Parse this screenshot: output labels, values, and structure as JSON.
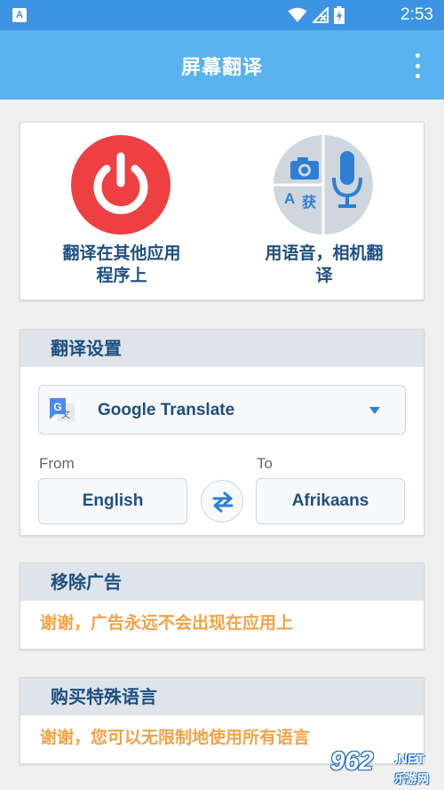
{
  "status_bar": {
    "notification_letter": "A",
    "time": "2:53"
  },
  "app_bar": {
    "title": "屏幕翻译"
  },
  "actions": {
    "translate_in_apps": {
      "label_line1": "翻译在其他应用",
      "label_line2": "程序上"
    },
    "voice_camera": {
      "label_line1": "用语音，相机翻",
      "label_line2": "译",
      "badge_letter": "A",
      "badge_char": "获"
    }
  },
  "settings": {
    "header": "翻译设置",
    "engine": "Google Translate",
    "from_label": "From",
    "to_label": "To",
    "from_language": "English",
    "to_language": "Afrikaans"
  },
  "remove_ads": {
    "header": "移除广告",
    "message": "谢谢，广告永远不会出现在应用上"
  },
  "purchase_languages": {
    "header": "购买特殊语言",
    "message": "谢谢，您可以无限制地使用所有语言"
  },
  "watermark": {
    "brand": "962",
    "tld": ".NET",
    "sub": "乐游网"
  },
  "colors": {
    "status_bar": "#3d94e4",
    "app_bar": "#5ab2ef",
    "header_text": "#1e4f80",
    "accent_orange": "#f0a346",
    "power_red": "#ee3f43",
    "icon_blue": "#2e7ed3"
  },
  "icons": {
    "status": [
      "wifi-icon",
      "no-signal-icon",
      "battery-charging-icon"
    ],
    "power": "power-icon",
    "camera": "camera-icon",
    "microphone": "microphone-icon",
    "translate_engine": "google-translate-icon",
    "swap": "swap-arrows-icon",
    "menu": "overflow-menu-icon"
  }
}
